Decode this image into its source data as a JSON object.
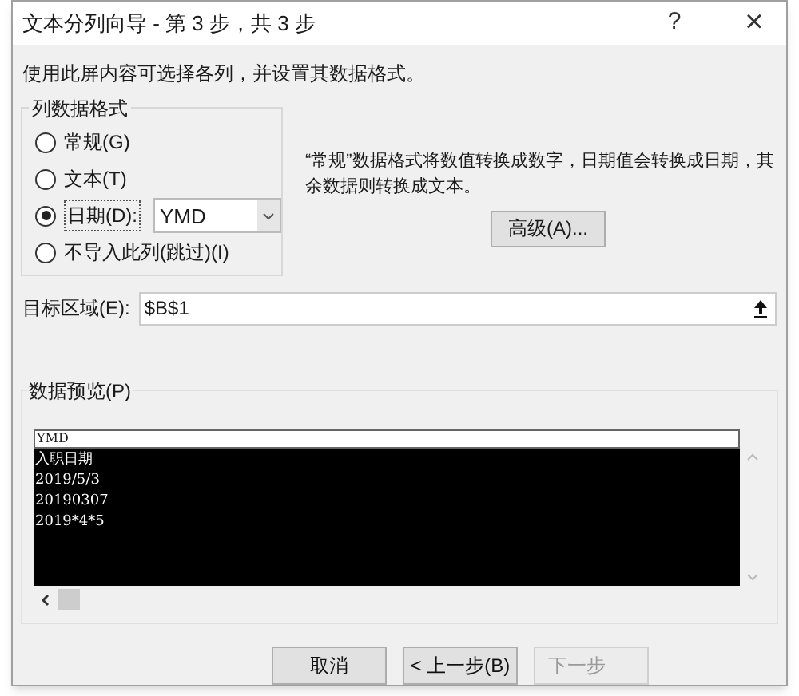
{
  "window": {
    "title": "文本分列向导 - 第 3 步，共 3 步",
    "help": "?",
    "close": "×"
  },
  "instruction": "使用此屏内容可选择各列，并设置其数据格式。",
  "column_format": {
    "title": "列数据格式",
    "options": [
      {
        "label": "常规(G)",
        "selected": false
      },
      {
        "label": "文本(T)",
        "selected": false
      },
      {
        "label": "日期(D):",
        "selected": true
      },
      {
        "label": "不导入此列(跳过)(I)",
        "selected": false
      }
    ],
    "date_format": "YMD"
  },
  "description": "“常规”数据格式将数值转换成数字，日期值会转换成日期，其余数据则转换成文本。",
  "advanced_button": "高级(A)...",
  "destination": {
    "label": "目标区域(E):",
    "value": "$B$1"
  },
  "preview": {
    "title": "数据预览(P)",
    "header": "YMD",
    "rows": [
      "入职日期",
      "2019/5/3",
      "20190307",
      "2019*4*5"
    ]
  },
  "buttons": [
    {
      "label": "取消",
      "disabled": false
    },
    {
      "label": "< 上一步(B)",
      "disabled": false
    },
    {
      "label": "下一步",
      "disabled": true
    }
  ]
}
